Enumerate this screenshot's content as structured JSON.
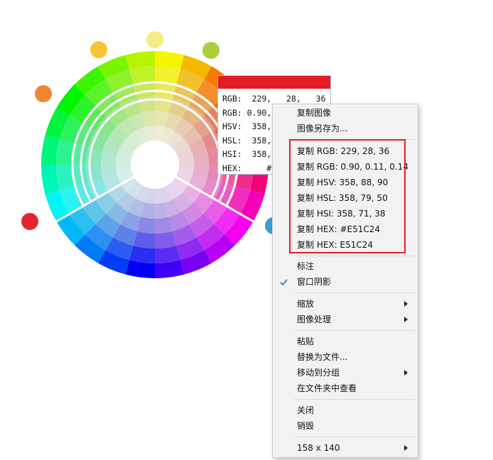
{
  "colors": {
    "picked": "#E51C24",
    "menu_bg": "#f2f2f2",
    "highlight_border": "#e0202a",
    "check": "#3a7bd5"
  },
  "picker": {
    "rows": [
      "RGB:  229,   28,   36",
      "RGB: 0.90,",
      "HSV:  358,",
      "HSL:  358,",
      "HSI:  358,",
      "HEX:     #"
    ]
  },
  "menu": {
    "copy_image": "复制图像",
    "save_image_as": "图像另存为...",
    "copy_rgb": "复制 RGB: 229, 28, 36",
    "copy_rgb_float": "复制 RGB: 0.90, 0.11, 0.14",
    "copy_hsv": "复制 HSV: 358, 88, 90",
    "copy_hsl": "复制 HSL: 358, 79, 50",
    "copy_hsi": "复制 HSI: 358, 71, 38",
    "copy_hex_hash": "复制 HEX: #E51C24",
    "copy_hex": "复制 HEX: E51C24",
    "annotate": "标注",
    "window_shadow": "窗口阴影",
    "zoom": "缩放",
    "image_processing": "图像处理",
    "paste": "粘贴",
    "replace_with_file": "替换为文件...",
    "move_to_group": "移动到分组",
    "view_in_folder": "在文件夹中查看",
    "close": "关闭",
    "destroy": "销毁",
    "size": "158 x 140"
  },
  "icons": {
    "check": "check-icon",
    "submenu": "chevron-right-icon"
  }
}
